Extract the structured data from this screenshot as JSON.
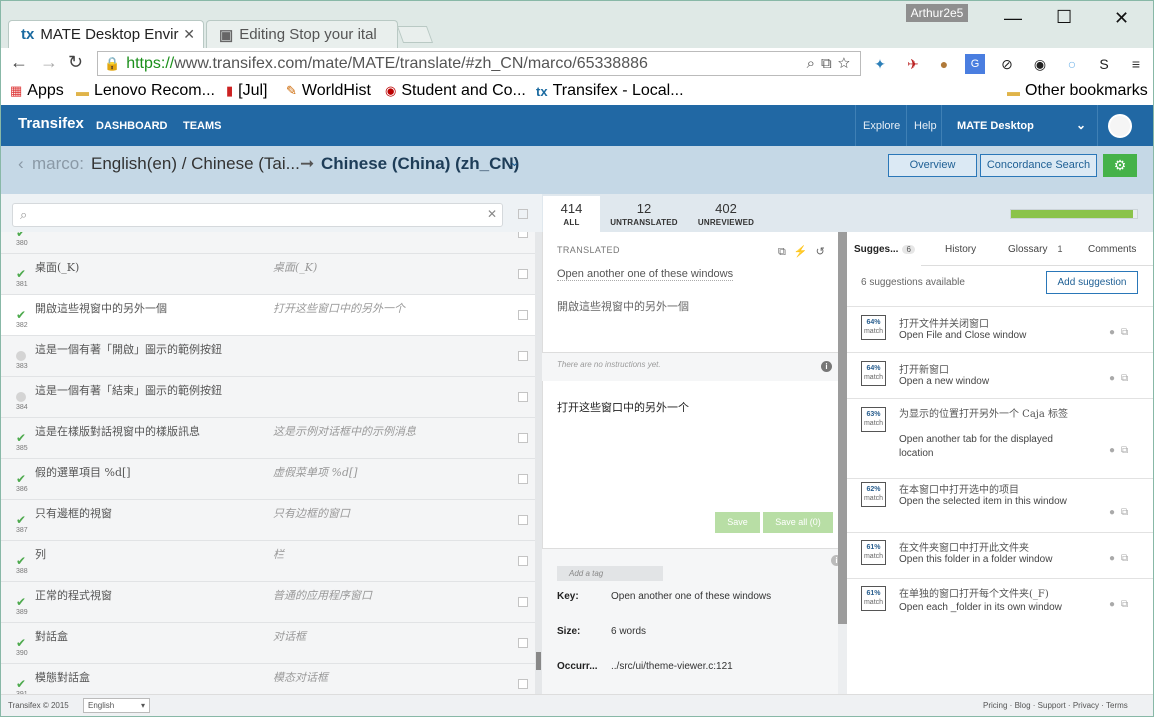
{
  "browser": {
    "tabs": [
      {
        "label": "MATE Desktop Enviro",
        "active": true
      },
      {
        "label": "Editing Stop your ital",
        "active": false
      }
    ],
    "user": "Arthur2e5",
    "url_scheme": "https://",
    "url_rest": "www.transifex.com/mate/MATE/translate/#zh_CN/marco/65338886",
    "bookmarks": [
      "Apps",
      "Lenovo Recom...",
      "[Jul]",
      "WorldHist",
      "Student and Co...",
      "Transifex - Local..."
    ],
    "other_bookmarks": "Other bookmarks"
  },
  "header": {
    "logo": "Transifex",
    "nav": [
      "DASHBOARD",
      "TEAMS"
    ],
    "right_nav": [
      "Explore",
      "Help"
    ],
    "project": "MATE Desktop"
  },
  "breadcrumb": {
    "resource": "marco:",
    "source": "English(en) / Chinese (Tai...",
    "arrow": "➞",
    "target": "Chinese (China) (zh_CN)"
  },
  "actions": {
    "overview": "Overview",
    "concordance": "Concordance Search"
  },
  "stats": [
    {
      "num": "414",
      "label": "ALL"
    },
    {
      "num": "12",
      "label": "UNTRANSLATED"
    },
    {
      "num": "402",
      "label": "UNREVIEWED"
    }
  ],
  "progress_fraction": 0.97,
  "rows": [
    {
      "num": "380",
      "status": "ok",
      "src": "",
      "tgt": ""
    },
    {
      "num": "381",
      "status": "ok",
      "src": "桌面(_K)",
      "tgt": "桌面(_K)"
    },
    {
      "num": "382",
      "status": "ok",
      "src": "開啟這些視窗中的另外一個",
      "tgt": "打开这些窗口中的另外一个"
    },
    {
      "num": "383",
      "status": "empty",
      "src": "這是一個有著「開啟」圖示的範例按鈕",
      "tgt": ""
    },
    {
      "num": "384",
      "status": "empty",
      "src": "這是一個有著「結束」圖示的範例按鈕",
      "tgt": ""
    },
    {
      "num": "385",
      "status": "ok",
      "src": "這是在樣版對話視窗中的樣版訊息",
      "tgt": "这是示例对话框中的示例消息"
    },
    {
      "num": "386",
      "status": "ok",
      "src": "假的選單項目 %d[]",
      "tgt": "虚假菜单项 %d[]"
    },
    {
      "num": "387",
      "status": "ok",
      "src": "只有邊框的視窗",
      "tgt": "只有边框的窗口"
    },
    {
      "num": "388",
      "status": "ok",
      "src": "列",
      "tgt": "栏"
    },
    {
      "num": "389",
      "status": "ok",
      "src": "正常的程式視窗",
      "tgt": "普通的应用程序窗口"
    },
    {
      "num": "390",
      "status": "ok",
      "src": "對話盒",
      "tgt": "对话框"
    },
    {
      "num": "391",
      "status": "ok",
      "src": "模態對話盒",
      "tgt": "模态对话框"
    }
  ],
  "editor": {
    "label": "TRANSLATED",
    "source_en": "Open another one of these windows",
    "source_zh": "開啟這些視窗中的另外一個",
    "instructions": "There are no instructions yet.",
    "translation": "打开这些窗口中的另外一个",
    "save": "Save",
    "save_all": "Save all (0)",
    "tag_placeholder": "Add a tag",
    "meta": [
      {
        "k": "Key:",
        "v": "Open another one of these windows"
      },
      {
        "k": "Size:",
        "v": "6 words"
      },
      {
        "k": "Occurr...",
        "v": "../src/ui/theme-viewer.c:121"
      }
    ]
  },
  "suggestions_panel": {
    "tabs": [
      {
        "label": "Sugges...",
        "badge": "6"
      },
      {
        "label": "History",
        "badge": ""
      },
      {
        "label": "Glossary",
        "badge": "1"
      },
      {
        "label": "Comments",
        "badge": ""
      }
    ],
    "count_text": "6 suggestions available",
    "add_label": "Add suggestion",
    "match_label": "match",
    "items": [
      {
        "pct": "64%",
        "zh": "打开文件并关闭窗口",
        "en": "Open File and Close window"
      },
      {
        "pct": "64%",
        "zh": "打开新窗口",
        "en": "Open a new window"
      },
      {
        "pct": "63%",
        "zh": "为显示的位置打开另外一个 Caja 标签",
        "en": "Open another tab for the displayed location"
      },
      {
        "pct": "62%",
        "zh": "在本窗口中打开选中的项目",
        "en": "Open the selected item in this window"
      },
      {
        "pct": "61%",
        "zh": "在文件夹窗口中打开此文件夹",
        "en": "Open this folder in a folder window"
      },
      {
        "pct": "61%",
        "zh": "在单独的窗口打开每个文件夹(_F)",
        "en": "Open each _folder in its own window"
      }
    ]
  },
  "footer": {
    "copyright": "Transifex © 2015",
    "language": "English",
    "links": "Pricing · Blog · Support · Privacy · Terms"
  }
}
